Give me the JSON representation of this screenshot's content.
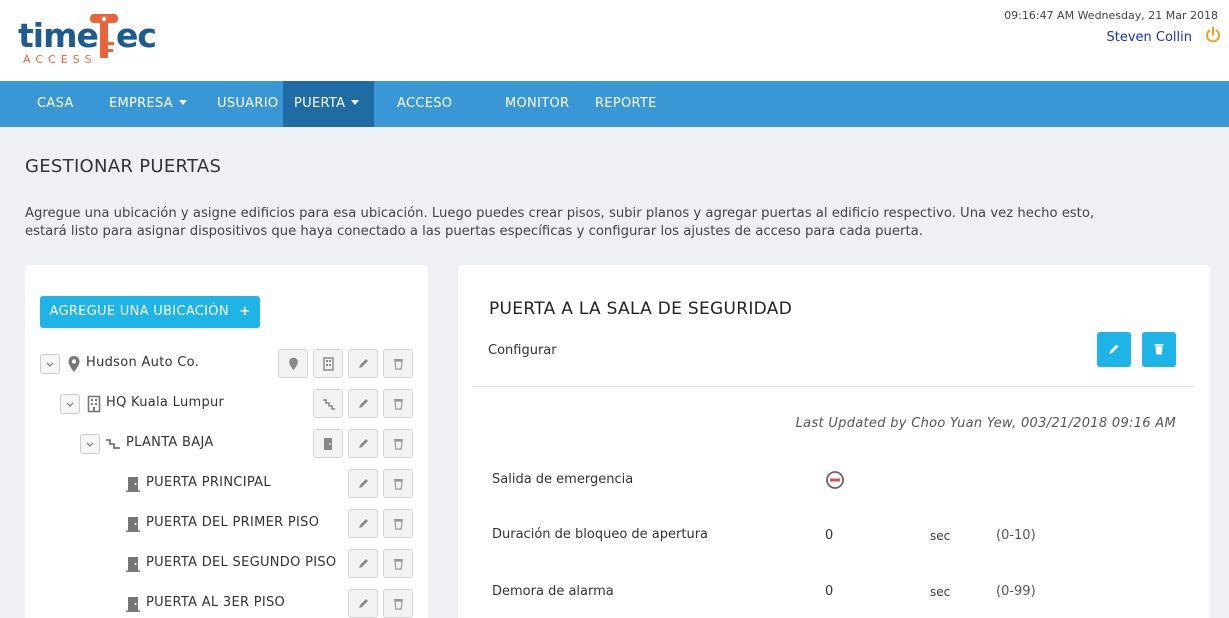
{
  "header": {
    "logo_part1": "time",
    "logo_part2": "ec",
    "logo_sub": "ACCESS",
    "datetime": "09:16:47 AM Wednesday, 21 Mar 2018",
    "user": "Steven Collin",
    "power_icon": "power-icon"
  },
  "nav": {
    "items": [
      {
        "label": "CASA"
      },
      {
        "label": "EMPRESA"
      },
      {
        "label": "USUARIO"
      },
      {
        "label": "PUERTA"
      },
      {
        "label": "ACCESO"
      },
      {
        "label": "MONITOR"
      },
      {
        "label": "REPORTE"
      }
    ],
    "active": "PUERTA"
  },
  "page": {
    "title": "GESTIONAR PUERTAS",
    "description": "Agregue una ubicación y asigne edificios para esa ubicación. Luego puedes crear pisos, subir planos y agregar puertas al edificio respectivo. Una vez hecho esto, estará listo para asignar dispositivos que haya conectado a las puertas específicas y configurar los ajustes de acceso para cada puerta."
  },
  "tree": {
    "add_button": "AGREGUE UNA UBICACIÓN",
    "nodes": [
      {
        "label": "Hudson Auto Co.",
        "type": "location"
      },
      {
        "label": "HQ Kuala Lumpur",
        "type": "building"
      },
      {
        "label": "PLANTA BAJA",
        "type": "floor"
      },
      {
        "label": "PUERTA PRINCIPAL",
        "type": "door"
      },
      {
        "label": "PUERTA DEL PRIMER PISO",
        "type": "door"
      },
      {
        "label": "PUERTA DEL SEGUNDO PISO",
        "type": "door"
      },
      {
        "label": "PUERTA AL 3ER PISO",
        "type": "door"
      }
    ]
  },
  "detail": {
    "title": "PUERTA A LA SALA DE SEGURIDAD",
    "subtitle": "Configurar",
    "last_updated": "Last Updated by Choo Yuan Yew, 003/21/2018 09:16 AM",
    "settings": [
      {
        "label": "Salida de emergencia",
        "value": "disabled"
      },
      {
        "label": "Duración de bloqueo de apertura",
        "value": "0",
        "unit": "sec",
        "range": "(0-10)"
      },
      {
        "label": "Demora de alarma",
        "value": "0",
        "unit": "sec",
        "range": "(0-99)"
      }
    ]
  },
  "colors": {
    "nav_bg": "#3a97d6",
    "nav_active": "#1f6ba3",
    "accent": "#1eb4e8",
    "brand_blue": "#1f5b8e",
    "brand_orange": "#e8643a"
  }
}
